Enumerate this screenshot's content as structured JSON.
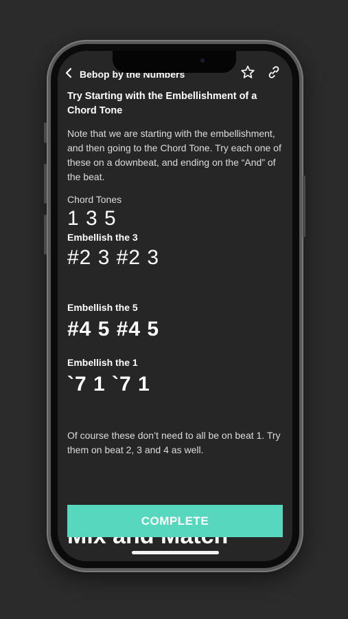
{
  "nav": {
    "back_icon": "chevron-left-icon",
    "title": "Bebop by the Numbers",
    "star_icon": "star-icon",
    "link_icon": "link-icon"
  },
  "lesson": {
    "title": "Try Starting with the Embellishment of a Chord Tone",
    "intro": "Note that we are starting with the embellishment, and then going to the Chord Tone. Try each one of these on a downbeat, and ending on the “And” of the beat.",
    "chord_tones_label": "Chord Tones",
    "chord_tones": "1 3 5",
    "sections": [
      {
        "label": "Embellish the 3",
        "notes": "#2 3 #2 3"
      },
      {
        "label": "Embellish the 5",
        "notes": "#4 5 #4 5"
      },
      {
        "label": "Embellish the 1",
        "notes": "`7 1 `7 1"
      }
    ],
    "outro": "Of course these don’t need to all be on beat 1. Try them on beat 2, 3 and 4 as well.",
    "next_heading": "Mix and Match"
  },
  "actions": {
    "complete_label": "COMPLETE"
  },
  "colors": {
    "accent": "#58d7bf",
    "screen_bg": "#262626",
    "page_bg": "#2b2b2b"
  }
}
